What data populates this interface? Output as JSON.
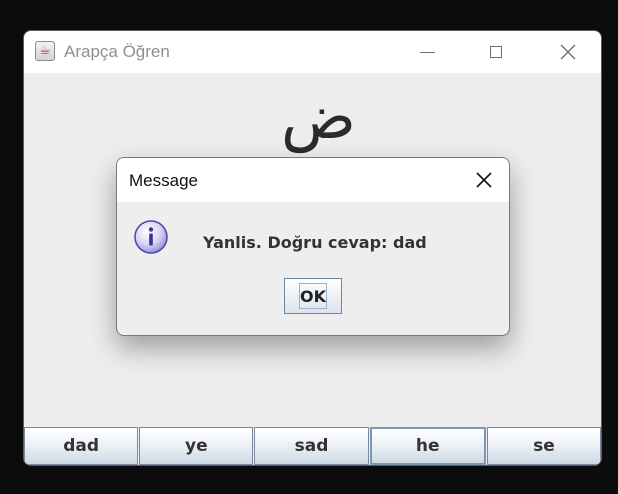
{
  "window": {
    "title": "Arapça Öğren",
    "icon": "java-cup-icon"
  },
  "main": {
    "letter": "ض",
    "answers": [
      "dad",
      "ye",
      "sad",
      "he",
      "se"
    ]
  },
  "dialog": {
    "title": "Message",
    "icon": "info-icon",
    "message": "Yanlis. Doğru cevap: dad",
    "ok_label": "OK"
  },
  "colors": {
    "window_bg": "#eeeeee",
    "titlebar_bg": "#ffffff",
    "button_border": "#7a8a9c"
  }
}
